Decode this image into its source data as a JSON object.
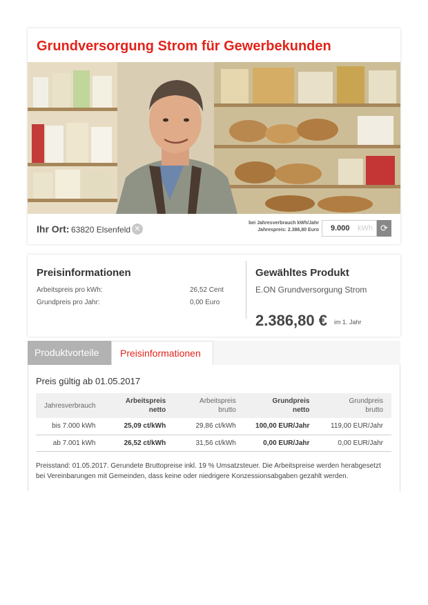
{
  "page": {
    "title": "Grundversorgung Strom für Gewerbekunden"
  },
  "location": {
    "label": "Ihr Ort:",
    "value": "63820 Elsenfeld",
    "consumption_line1": "bei Jahresverbrauch kWh/Jahr",
    "consumption_line2": "Jahrespreis: 2.386,80 Euro",
    "kwh_value": "9.000",
    "kwh_unit": "kWh"
  },
  "price_info": {
    "title": "Preisinformationen",
    "rows": [
      {
        "label": "Arbeitspreis pro kWh:",
        "value": "26,52 Cent"
      },
      {
        "label": "Grundpreis pro Jahr:",
        "value": "0,00 Euro"
      }
    ]
  },
  "selected_product": {
    "title": "Gewähltes Produkt",
    "name": "E.ON Grundversorgung Strom",
    "price": "2.386,80 €",
    "price_note": "im 1. Jahr"
  },
  "tabs": [
    {
      "label": "Produktvorteile",
      "active": false
    },
    {
      "label": "Preisinformationen",
      "active": true
    }
  ],
  "tariff": {
    "valid_from": "Preis gültig ab 01.05.2017",
    "headers": [
      {
        "l1": "Jahresverbrauch",
        "l2": ""
      },
      {
        "l1": "Arbeitspreis",
        "l2": "netto"
      },
      {
        "l1": "Arbeitspreis",
        "l2": "brutto"
      },
      {
        "l1": "Grundpreis",
        "l2": "netto"
      },
      {
        "l1": "Grundpreis",
        "l2": "brutto"
      }
    ],
    "rows": [
      [
        "bis 7.000 kWh",
        "25,09 ct/kWh",
        "29,86 ct/kWh",
        "100,00 EUR/Jahr",
        "119,00 EUR/Jahr"
      ],
      [
        "ab 7.001 kWh",
        "26,52 ct/kWh",
        "31,56 ct/kWh",
        "0,00 EUR/Jahr",
        "0,00 EUR/Jahr"
      ]
    ],
    "note": "Preisstand: 01.05.2017. Gerundete Bruttopreise inkl. 19 % Umsatzsteuer.  Die Arbeitspreise werden herabgesetzt bei Vereinbarungen mit Gemeinden, dass keine oder niedrigere Konzessionsabgaben gezahlt werden."
  },
  "colors": {
    "brand_red": "#e2231a",
    "tab_inactive": "#b2b2b2"
  },
  "icons": {
    "clear": "close-circle-icon",
    "refresh": "refresh-icon"
  }
}
